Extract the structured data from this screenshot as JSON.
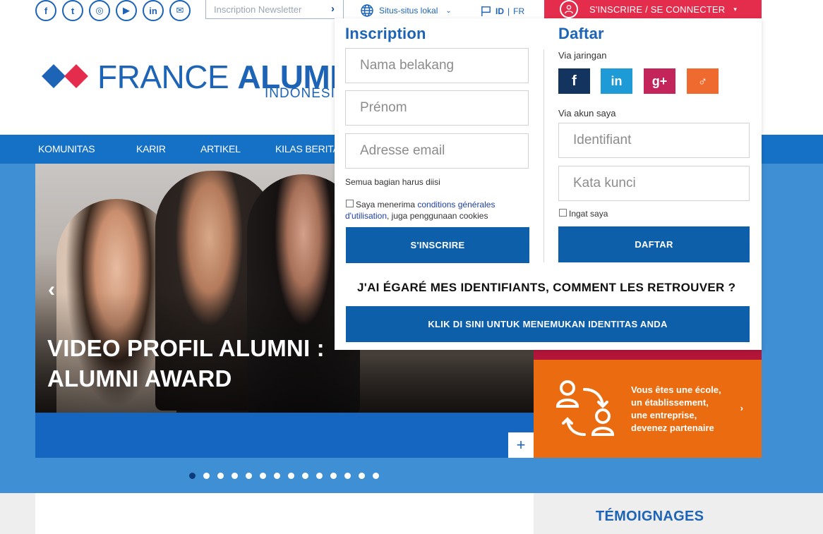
{
  "topbar": {
    "social_icons": [
      {
        "name": "facebook-icon",
        "glyph": "f"
      },
      {
        "name": "twitter-icon",
        "glyph": "t"
      },
      {
        "name": "instagram-icon",
        "glyph": "◎"
      },
      {
        "name": "youtube-icon",
        "glyph": "▶"
      },
      {
        "name": "linkedin-icon",
        "glyph": "in"
      },
      {
        "name": "mail-icon",
        "glyph": "✉"
      }
    ],
    "newsletter_placeholder": "Inscription Newsletter",
    "local_sites_label": "Situs-situs lokal",
    "lang_active": "ID",
    "lang_separator": "|",
    "lang_other": "FR",
    "connect_label": "S'INSCRIRE / SE CONNECTER"
  },
  "logo": {
    "brand_light": "FRANCE ",
    "brand_bold": "ALUMNI",
    "country": "INDONESIA"
  },
  "nav": {
    "items": [
      "KOMUNITAS",
      "KARIR",
      "ARTIKEL",
      "KILAS BERITA"
    ]
  },
  "hero": {
    "caption_line1": "VIDEO PROFIL ALUMNI :",
    "caption_line2": "ALUMNI AWARD",
    "prev_arrow": "‹",
    "plus": "+",
    "dot_count": 14,
    "active_dot": 0
  },
  "partner": {
    "line1": "Vous êtes une école,",
    "line2": "un établissement,",
    "line3": "une entreprise,",
    "line4": "devenez partenaire",
    "arrow": "›"
  },
  "below": {
    "testimonials_title": "TÉMOIGNAGES"
  },
  "panel": {
    "register": {
      "title": "Inscription",
      "last_name_placeholder": "Nama belakang",
      "first_name_placeholder": "Prénom",
      "email_placeholder": "Adresse email",
      "required_note": "Semua bagian harus diisi",
      "terms_prefix": "Saya menerima ",
      "terms_link": "conditions générales",
      "terms_link2": "d'utilisation",
      "terms_suffix": ", juga penggunaan cookies",
      "submit": "S'INSCRIRE"
    },
    "login": {
      "title": "Daftar",
      "via_network": "Via jaringan",
      "social_buttons": [
        {
          "name": "facebook-login-button",
          "glyph": "f",
          "color": "#12345f"
        },
        {
          "name": "linkedin-login-button",
          "glyph": "in",
          "color": "#1e9ad6"
        },
        {
          "name": "googleplus-login-button",
          "glyph": "g+",
          "color": "#c3245a"
        },
        {
          "name": "viadeo-login-button",
          "glyph": "♂",
          "color": "#ef6a2e"
        }
      ],
      "via_account": "Via akun saya",
      "identifier_placeholder": "Identifiant",
      "password_placeholder": "Kata kunci",
      "remember_me": "Ingat saya",
      "submit": "DAFTAR"
    },
    "lost_title": "J'AI ÉGARÉ MES IDENTIFIANTS, COMMENT LES RETROUVER ?",
    "lost_button": "KLIK DI SINI UNTUK MENEMUKAN IDENTITAS ANDA"
  },
  "colors": {
    "brand_blue": "#1d64b6",
    "nav_blue": "#1571c6",
    "hero_blue": "#3e8fd4",
    "button_blue": "#0e5fa9",
    "connect_red": "#e42c4c",
    "partner_orange": "#ea6b10"
  }
}
